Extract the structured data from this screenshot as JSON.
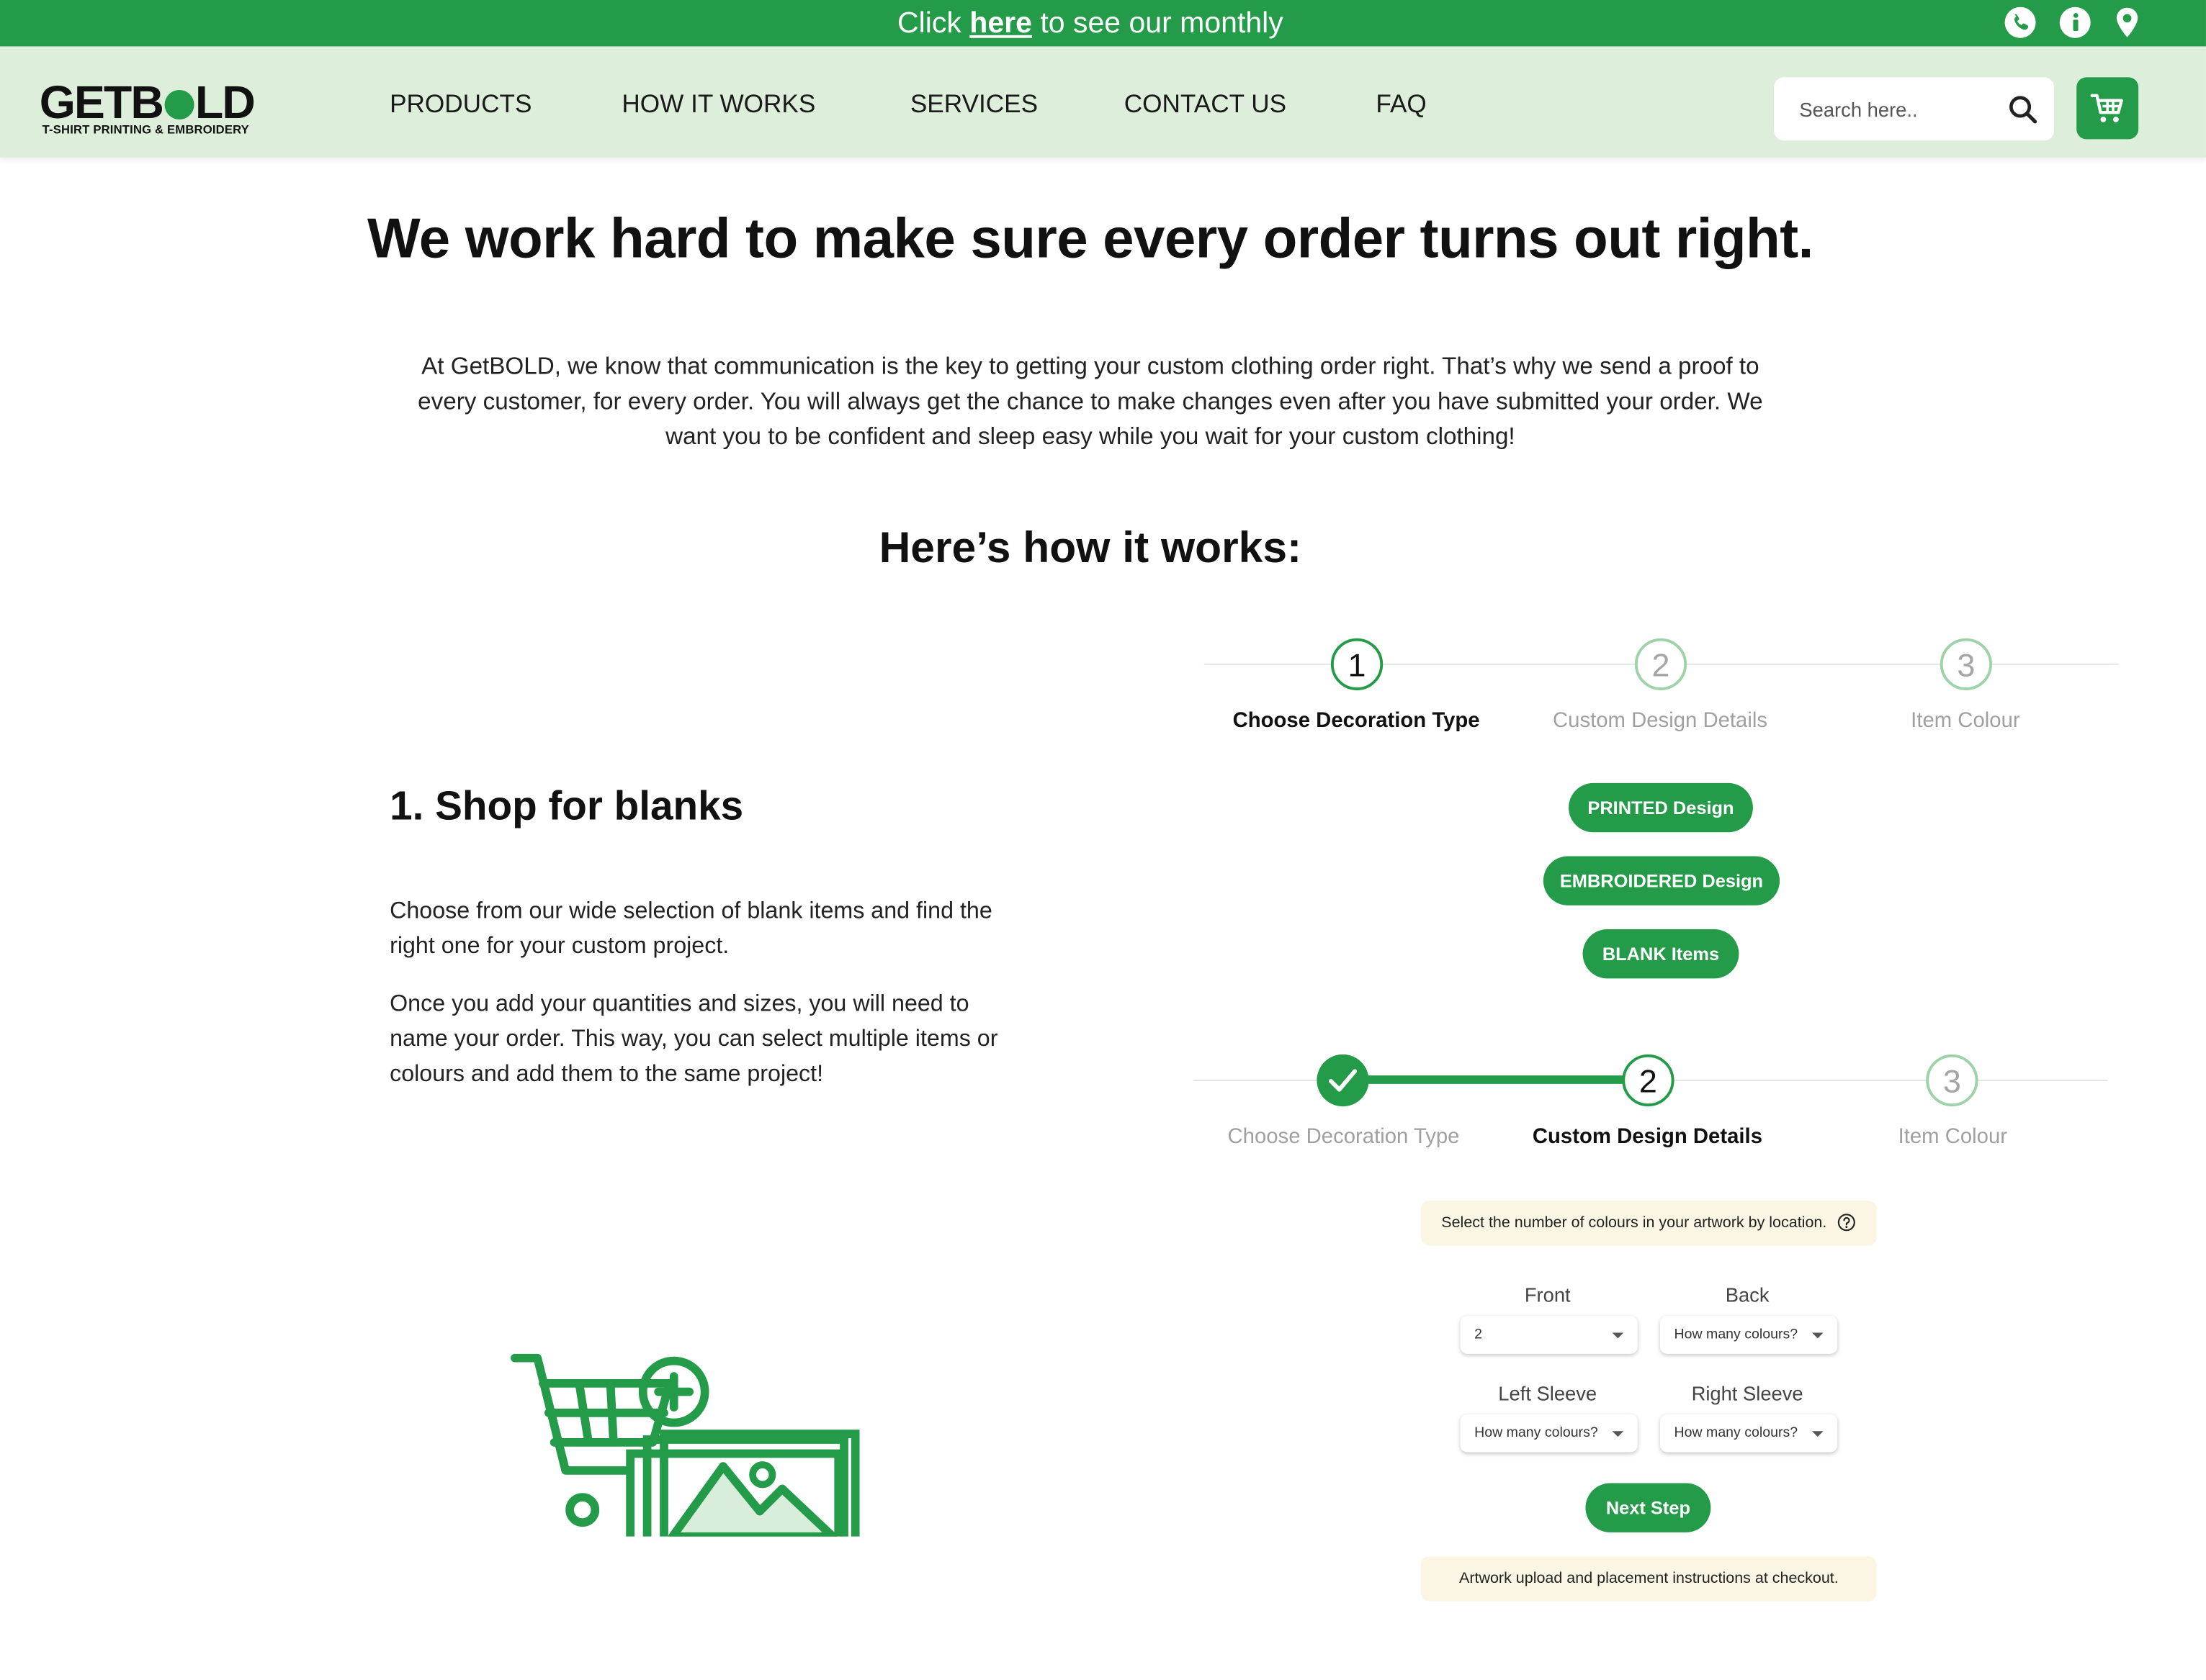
{
  "promo": {
    "before": "Click",
    "link": "here",
    "after": "to see our monthly"
  },
  "top_icons": [
    "phone-icon",
    "info-icon",
    "location-pin-icon"
  ],
  "logo": {
    "word_left": "GETB",
    "word_right": "LD",
    "tagline": "T-SHIRT PRINTING & EMBROIDERY"
  },
  "nav": {
    "products": "PRODUCTS",
    "how_it_works": "HOW IT WORKS",
    "services": "SERVICES",
    "contact_us": "CONTACT US",
    "faq": "FAQ"
  },
  "search": {
    "placeholder": "Search here.."
  },
  "hero": {
    "title": "We work hard to make sure every order turns out right.",
    "intro": "At GetBOLD, we know that communication is the key to getting your custom clothing order right. That’s why we send a proof to every customer, for every order. You will always get the chance to make changes even after you have submitted your order. We want you to be confident and sleep easy while you wait for your custom clothing!"
  },
  "how": {
    "title": "Here’s how it works:"
  },
  "step1": {
    "title": "1. Shop for blanks",
    "p1": "Choose from our wide selection of blank items and find the right one for your custom project.",
    "p2": "Once you add your quantities and sizes, you will need to name your order. This way, you can select multiple items or colours and add them to the same project!"
  },
  "stepper": {
    "s1_num": "1",
    "s2_num": "2",
    "s3_num": "3",
    "s1_label": "Choose Decoration Type",
    "s2_label": "Custom Design Details",
    "s3_label": "Item Colour"
  },
  "decoration_buttons": {
    "printed": "PRINTED Design",
    "embroidered": "EMBROIDERED Design",
    "blank": "BLANK Items"
  },
  "design_details": {
    "colour_note": "Select the number of colours in your artwork by location.",
    "front_label": "Front",
    "front_value": "2",
    "back_label": "Back",
    "back_value": "How many colours?",
    "left_label": "Left Sleeve",
    "left_value": "How many colours?",
    "right_label": "Right Sleeve",
    "right_value": "How many colours?",
    "next_step": "Next Step",
    "artwork_note": "Artwork upload and placement instructions at checkout."
  },
  "colors": {
    "brand_green": "#239b49",
    "header_bg": "#ddefdb",
    "note_bg": "#fbf6e4"
  }
}
